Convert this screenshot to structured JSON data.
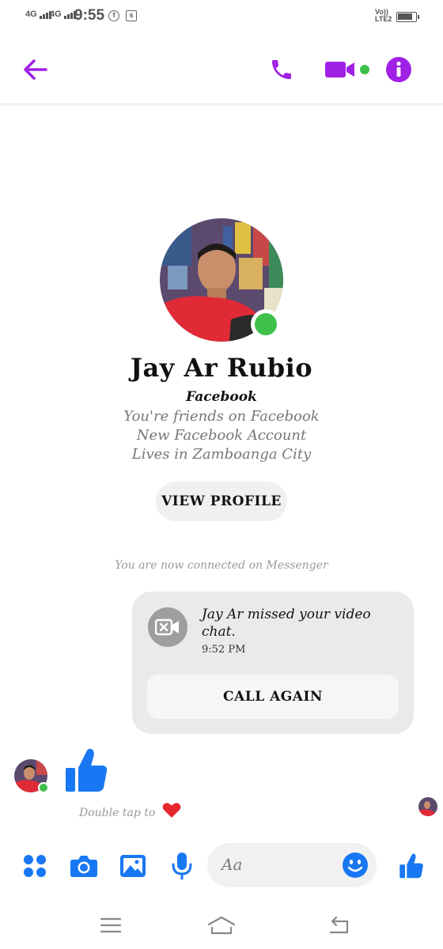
{
  "status_bar": {
    "network1": "4G",
    "network2": "4G",
    "time": "9:55",
    "volte_line1": "Vo))",
    "volte_line2": "LTE2",
    "icons": [
      "signal-icon",
      "signal-icon",
      "facebook-icon",
      "screenshot-icon",
      "battery-icon"
    ]
  },
  "header": {
    "back_icon": "arrow-left-icon",
    "call_icon": "phone-icon",
    "video_icon": "video-camera-icon",
    "info_icon": "info-icon"
  },
  "profile": {
    "name": "Jay Ar Rubio",
    "source": "Facebook",
    "friends": "You're friends on Facebook",
    "account": "New Facebook Account",
    "location": "Lives in Zamboanga City",
    "view_profile_label": "VIEW PROFILE"
  },
  "thread": {
    "connected_notice": "You are now connected on Messenger",
    "missed_call": {
      "text": "Jay Ar missed your video chat.",
      "time": "9:52 PM",
      "call_again_label": "CALL AGAIN"
    },
    "double_tap_hint": "Double tap to"
  },
  "composer": {
    "placeholder": "Aa",
    "icons": [
      "apps-icon",
      "camera-icon",
      "gallery-icon",
      "microphone-icon",
      "emoji-icon",
      "like-icon"
    ]
  },
  "navigation": {
    "icons": [
      "menu-icon",
      "home-icon",
      "back-icon"
    ]
  },
  "colors": {
    "accent": "#a020e6",
    "messenger_blue": "#1877f2",
    "online_green": "#3fc04a"
  }
}
